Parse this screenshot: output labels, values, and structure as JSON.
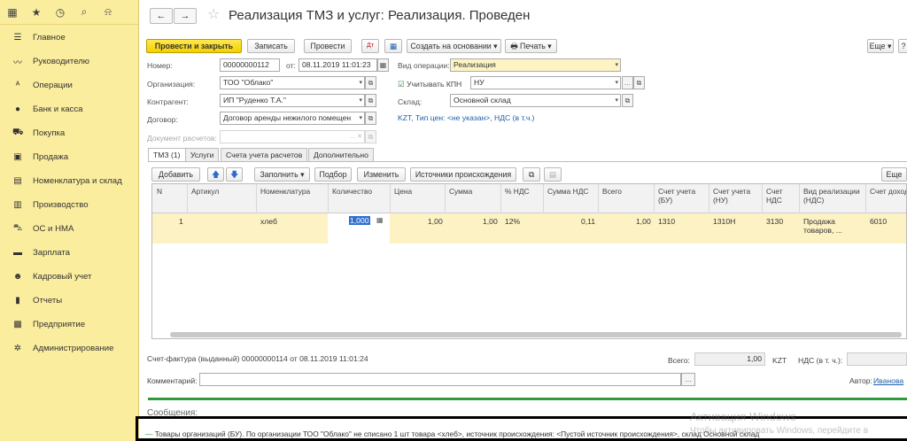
{
  "sidebar": {
    "top_icons": [
      "grid-icon",
      "star-icon",
      "history-icon",
      "search-icon",
      "bell-icon"
    ],
    "items": [
      {
        "label": "Главное",
        "icon": "menu-icon"
      },
      {
        "label": "Руководителю",
        "icon": "trend-icon"
      },
      {
        "label": "Операции",
        "icon": "operations-icon"
      },
      {
        "label": "Банк и касса",
        "icon": "bank-icon"
      },
      {
        "label": "Покупка",
        "icon": "cart-icon"
      },
      {
        "label": "Продажа",
        "icon": "bag-icon"
      },
      {
        "label": "Номенклатура и склад",
        "icon": "warehouse-icon"
      },
      {
        "label": "Производство",
        "icon": "factory-icon"
      },
      {
        "label": "ОС и НМА",
        "icon": "truck-icon"
      },
      {
        "label": "Зарплата",
        "icon": "money-icon"
      },
      {
        "label": "Кадровый учет",
        "icon": "people-icon"
      },
      {
        "label": "Отчеты",
        "icon": "report-icon"
      },
      {
        "label": "Предприятие",
        "icon": "enterprise-icon"
      },
      {
        "label": "Администрирование",
        "icon": "gear-icon"
      }
    ]
  },
  "header": {
    "back": "←",
    "forward": "→",
    "star": "☆",
    "title": "Реализация ТМЗ и услуг: Реализация. Проведен"
  },
  "toolbar": {
    "post_close": "Провести и закрыть",
    "save": "Записать",
    "post": "Провести",
    "create_based": "Создать на основании",
    "print": "Печать",
    "more": "Еще",
    "help": "?"
  },
  "form": {
    "number_label": "Номер:",
    "number_value": "00000000112",
    "date_label": "от:",
    "date_value": "08.11.2019 11:01:23",
    "op_label": "Вид операции:",
    "op_value": "Реализация",
    "org_label": "Организация:",
    "org_value": "ТОО \"Облако\"",
    "kpn_label": "Учитывать КПН",
    "kpn_value": "НУ",
    "contractor_label": "Контрагент:",
    "contractor_value": "ИП \"Руденко Т.А.\"",
    "warehouse_label": "Склад:",
    "warehouse_value": "Основной склад",
    "contract_label": "Договор:",
    "contract_value": "Договор аренды нежилого помещен",
    "price_link": "KZT, Тип цен: <не указан>, НДС (в т.ч.)",
    "calc_doc_label": "Документ расчетов:"
  },
  "tabs": [
    "ТМЗ (1)",
    "Услуги",
    "Счета учета расчетов",
    "Дополнительно"
  ],
  "table_toolbar": {
    "add": "Добавить",
    "fill": "Заполнить",
    "pick": "Подбор",
    "change": "Изменить",
    "sources": "Источники происхождения",
    "more": "Еще"
  },
  "table": {
    "headers": [
      "N",
      "Артикул",
      "Номенклатура",
      "Количество",
      "Цена",
      "Сумма",
      "% НДС",
      "Сумма НДС",
      "Всего",
      "Счет учета (БУ)",
      "Счет учета (НУ)",
      "Счет НДС",
      "Вид реализации (НДС)",
      "Счет доход"
    ],
    "rows": [
      {
        "n": "1",
        "article": "",
        "item": "хлеб",
        "qty": "1,000",
        "price": "1,00",
        "sum": "1,00",
        "vat_rate": "12%",
        "vat_sum": "0,11",
        "total": "1,00",
        "acc_bu": "1310",
        "acc_nu": "1310Н",
        "acc_vat": "3130",
        "sale_type": "Продажа товаров, ...",
        "acc_income": "6010"
      }
    ]
  },
  "footer": {
    "invoice": "Счет-фактура (выданный) 00000000114 от 08.11.2019 11:01:24",
    "total_label": "Всего:",
    "total_value": "1,00",
    "currency": "KZT",
    "vat_label": "НДС (в т. ч.):",
    "comment_label": "Комментарий:",
    "author_label": "Автор:",
    "author_value": "Иванова"
  },
  "messages": {
    "title": "Сообщения:",
    "text": "Товары организаций (БУ). По организации ТОО \"Облако\" не списано 1 шт товара <хлеб>, источник происхождения: <Пустой источник происхождения>, склад Основной склад"
  },
  "watermark": {
    "line1": "Активация Windows",
    "line2": "Чтобы активировать Windows, перейдите в"
  }
}
